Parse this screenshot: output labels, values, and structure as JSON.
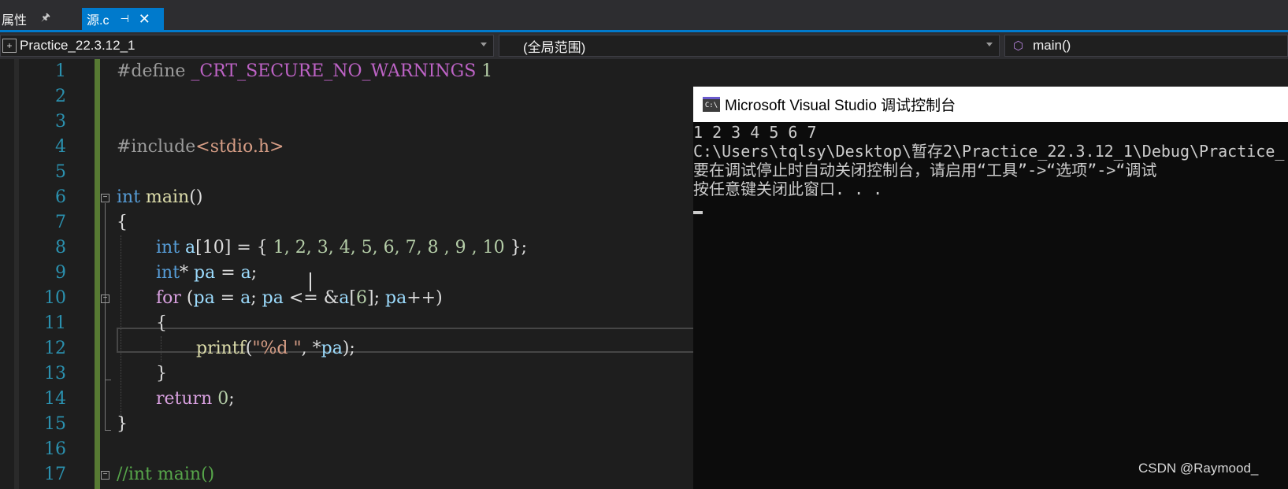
{
  "tabs": {
    "properties": "属性",
    "source": "源.c",
    "pin": " ⊏",
    "close": "✕"
  },
  "nav": {
    "project": "Practice_22.3.12_1",
    "scope": "(全局范围)",
    "function": "main()"
  },
  "code_lines": [
    {
      "n": "1"
    },
    {
      "n": "2"
    },
    {
      "n": "3"
    },
    {
      "n": "4"
    },
    {
      "n": "5"
    },
    {
      "n": "6"
    },
    {
      "n": "7"
    },
    {
      "n": "8"
    },
    {
      "n": "9"
    },
    {
      "n": "10"
    },
    {
      "n": "11"
    },
    {
      "n": "12"
    },
    {
      "n": "13"
    },
    {
      "n": "14"
    },
    {
      "n": "15"
    },
    {
      "n": "16"
    },
    {
      "n": "17"
    }
  ],
  "code": {
    "l1_a": "#define ",
    "l1_b": "_CRT_SECURE_NO_WARNINGS",
    "l1_c": " 1",
    "l4_a": "#include",
    "l4_b": "<stdio.h>",
    "l6_a": "int ",
    "l6_b": "main",
    "l6_c": "()",
    "l7": "{",
    "l8_a": "int ",
    "l8_b": "a",
    "l8_c": "[10] = { ",
    "l8_d": "1, 2, 3, 4, 5, 6, 7, 8 , 9 , 10",
    "l8_e": " };",
    "l9_a": "int",
    "l9_b": "* ",
    "l9_c": "pa",
    "l9_d": " = ",
    "l9_e": "a",
    "l9_f": ";",
    "l10_a": "for",
    "l10_b": " (",
    "l10_c": "pa",
    "l10_d": " = ",
    "l10_e": "a",
    "l10_f": "; ",
    "l10_g": "pa",
    "l10_h": " <= &",
    "l10_i": "a",
    "l10_j": "[",
    "l10_k": "6",
    "l10_l": "]; ",
    "l10_m": "pa",
    "l10_n": "++)",
    "l11": "{",
    "l12_a": "printf",
    "l12_b": "(",
    "l12_c": "\"%d \"",
    "l12_d": ", *",
    "l12_e": "pa",
    "l12_f": ");",
    "l13": "}",
    "l14_a": "return",
    "l14_b": " ",
    "l14_c": "0",
    "l14_d": ";",
    "l15": "}",
    "l17": "//int main()"
  },
  "console": {
    "title": "Microsoft Visual Studio 调试控制台",
    "icon": "C:\\",
    "lines": [
      "1 2 3 4 5 6 7",
      "C:\\Users\\tqlsy\\Desktop\\暂存2\\Practice_22.3.12_1\\Debug\\Practice_",
      "要在调试停止时自动关闭控制台，请启用“工具”->“选项”->“调试",
      "按任意键关闭此窗口. . ."
    ]
  },
  "watermark": "CSDN @Raymood_",
  "colors": {
    "accent": "#007acc",
    "editor_bg": "#1e1e1e",
    "console_bg": "#0c0c0c"
  }
}
